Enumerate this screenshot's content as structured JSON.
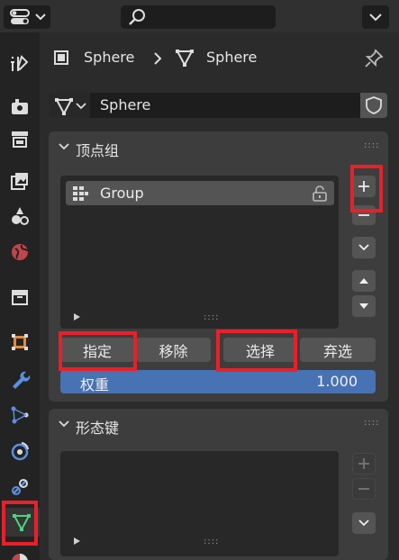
{
  "breadcrumb": {
    "object_name": "Sphere",
    "mesh_name": "Sphere"
  },
  "data_selector": {
    "value": "Sphere"
  },
  "vertex_groups": {
    "title": "顶点组",
    "items": [
      {
        "name": "Group"
      }
    ],
    "buttons": {
      "assign": "指定",
      "remove": "移除",
      "select": "选择",
      "deselect": "弃选"
    },
    "weight_label": "权重",
    "weight_value": "1.000"
  },
  "shape_keys": {
    "title": "形态键"
  },
  "colors": {
    "accent_blue": "#4772b3",
    "highlight_red": "#e8202a",
    "active_tab_green": "#4cd47a"
  },
  "icons": [
    "editor-type-icon",
    "search-icon",
    "chevron-down-icon",
    "object-icon",
    "mesh-data-icon",
    "pin-icon",
    "shield-icon",
    "vertex-group-icon",
    "lock-icon",
    "plus-icon",
    "minus-icon",
    "arrow-up-icon",
    "arrow-down-icon"
  ]
}
